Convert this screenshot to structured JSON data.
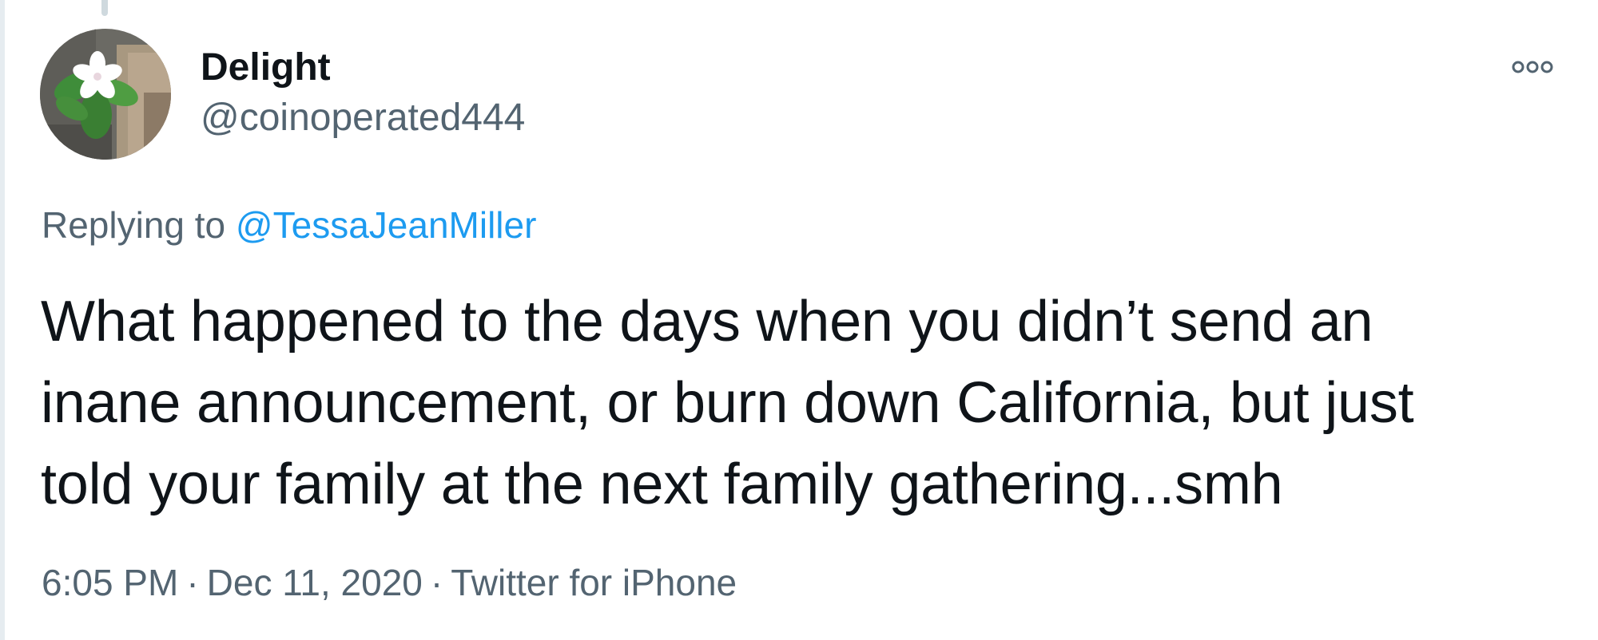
{
  "tweet": {
    "author": {
      "display_name": "Delight",
      "handle": "@coinoperated444",
      "avatar_icon": "flower-avatar"
    },
    "more_icon": "more-options-icon",
    "reply": {
      "prefix": "Replying to",
      "target": "@TessaJeanMiller"
    },
    "text_lines": [
      "What happened to the days when you didn’t send an",
      "inane announcement, or burn down California, but just",
      "told your family at the next family gathering...smh"
    ],
    "timestamp": {
      "time": "6:05 PM",
      "separator": "·",
      "date": "Dec 11, 2020",
      "source": "Twitter for iPhone"
    },
    "colors": {
      "link_blue": "#1d9bf0",
      "secondary_gray": "#536471",
      "primary_text": "#0f1419"
    }
  }
}
